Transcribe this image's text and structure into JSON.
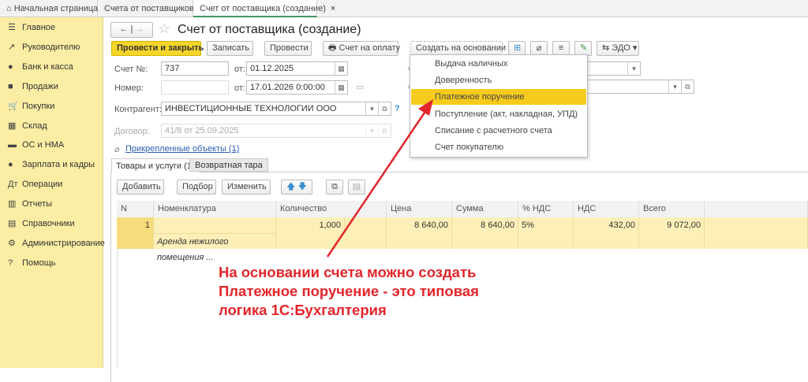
{
  "tabs": [
    {
      "label": "Начальная страница",
      "icon": "home-icon"
    },
    {
      "label": "Счета от поставщиков",
      "close": "×"
    },
    {
      "label": "Счет от поставщика (создание)",
      "close": "×"
    }
  ],
  "sidebar": {
    "items": [
      {
        "label": "Главное",
        "icon": "menu-icon",
        "glyph": "☰"
      },
      {
        "label": "Руководителю",
        "icon": "trend-icon",
        "glyph": "↗"
      },
      {
        "label": "Банк и касса",
        "icon": "ruble-coin-icon",
        "glyph": "●"
      },
      {
        "label": "Продажи",
        "icon": "bag-icon",
        "glyph": "■"
      },
      {
        "label": "Покупки",
        "icon": "cart-icon",
        "glyph": "🛒"
      },
      {
        "label": "Склад",
        "icon": "warehouse-icon",
        "glyph": "▦"
      },
      {
        "label": "ОС и НМА",
        "icon": "truck-icon",
        "glyph": "▬"
      },
      {
        "label": "Зарплата и кадры",
        "icon": "person-icon",
        "glyph": "●"
      },
      {
        "label": "Операции",
        "icon": "operations-icon",
        "glyph": "Дт"
      },
      {
        "label": "Отчеты",
        "icon": "chart-icon",
        "glyph": "▥"
      },
      {
        "label": "Справочники",
        "icon": "book-icon",
        "glyph": "▤"
      },
      {
        "label": "Администрирование",
        "icon": "gear-icon",
        "glyph": "⚙"
      },
      {
        "label": "Помощь",
        "icon": "help-icon",
        "glyph": "?"
      }
    ]
  },
  "header": {
    "title": "Счет от поставщика (создание)",
    "back": "←",
    "forward": "→",
    "star": "☆"
  },
  "toolbar": {
    "post_close": "Провести и закрыть",
    "save": "Записать",
    "post": "Провести",
    "invoice": "Счет на оплату",
    "create_based": "Создать на основании",
    "edo": "ЭДО"
  },
  "menu": {
    "items": [
      "Выдача наличных",
      "Доверенность",
      "Платежное поручение",
      "Поступление (акт, накладная, УПД)",
      "Списание с расчетного счета",
      "Счет покупателю"
    ],
    "highlighted": "Платежное поручение",
    "highlight_color": "#f7cb1e"
  },
  "form": {
    "invoice_no_label": "Счет №:",
    "invoice_no": "737",
    "from_label": "от:",
    "invoice_date": "01.12.2025",
    "number_label": "Номер:",
    "number": "",
    "doc_date": "17.01.2026  0:00:00",
    "contractor_label": "Контрагент:",
    "contractor": "ИНВЕСТИЦИОННЫЕ ТЕХНОЛОГИИ ООО",
    "help": "?",
    "contract_label": "Договор:",
    "contract": "41/8 от 25.09.2025",
    "attached": "Прикрепленные объекты (1)"
  },
  "doc_tabs": [
    "Товары и услуги (1)",
    "Возвратная тара"
  ],
  "table_toolbar": {
    "add": "Добавить",
    "pick": "Подбор",
    "edit": "Изменить"
  },
  "table": {
    "columns": [
      "N",
      "Номенклатура",
      "Количество",
      "Цена",
      "Сумма",
      "% НДС",
      "НДС",
      "Всего"
    ],
    "rows": [
      {
        "n": "1",
        "item": "Аренда нежилого помещения ...",
        "qty": "1,000",
        "price": "8 640,00",
        "sum": "8 640,00",
        "vat_rate": "5%",
        "vat": "432,00",
        "total": "9 072,00"
      }
    ]
  },
  "annotation": {
    "lines": [
      "На основании счета можно создать",
      "Платежное поручение - это типовая",
      "логика 1С:Бухгалтерия"
    ],
    "color": "#e3262b"
  }
}
